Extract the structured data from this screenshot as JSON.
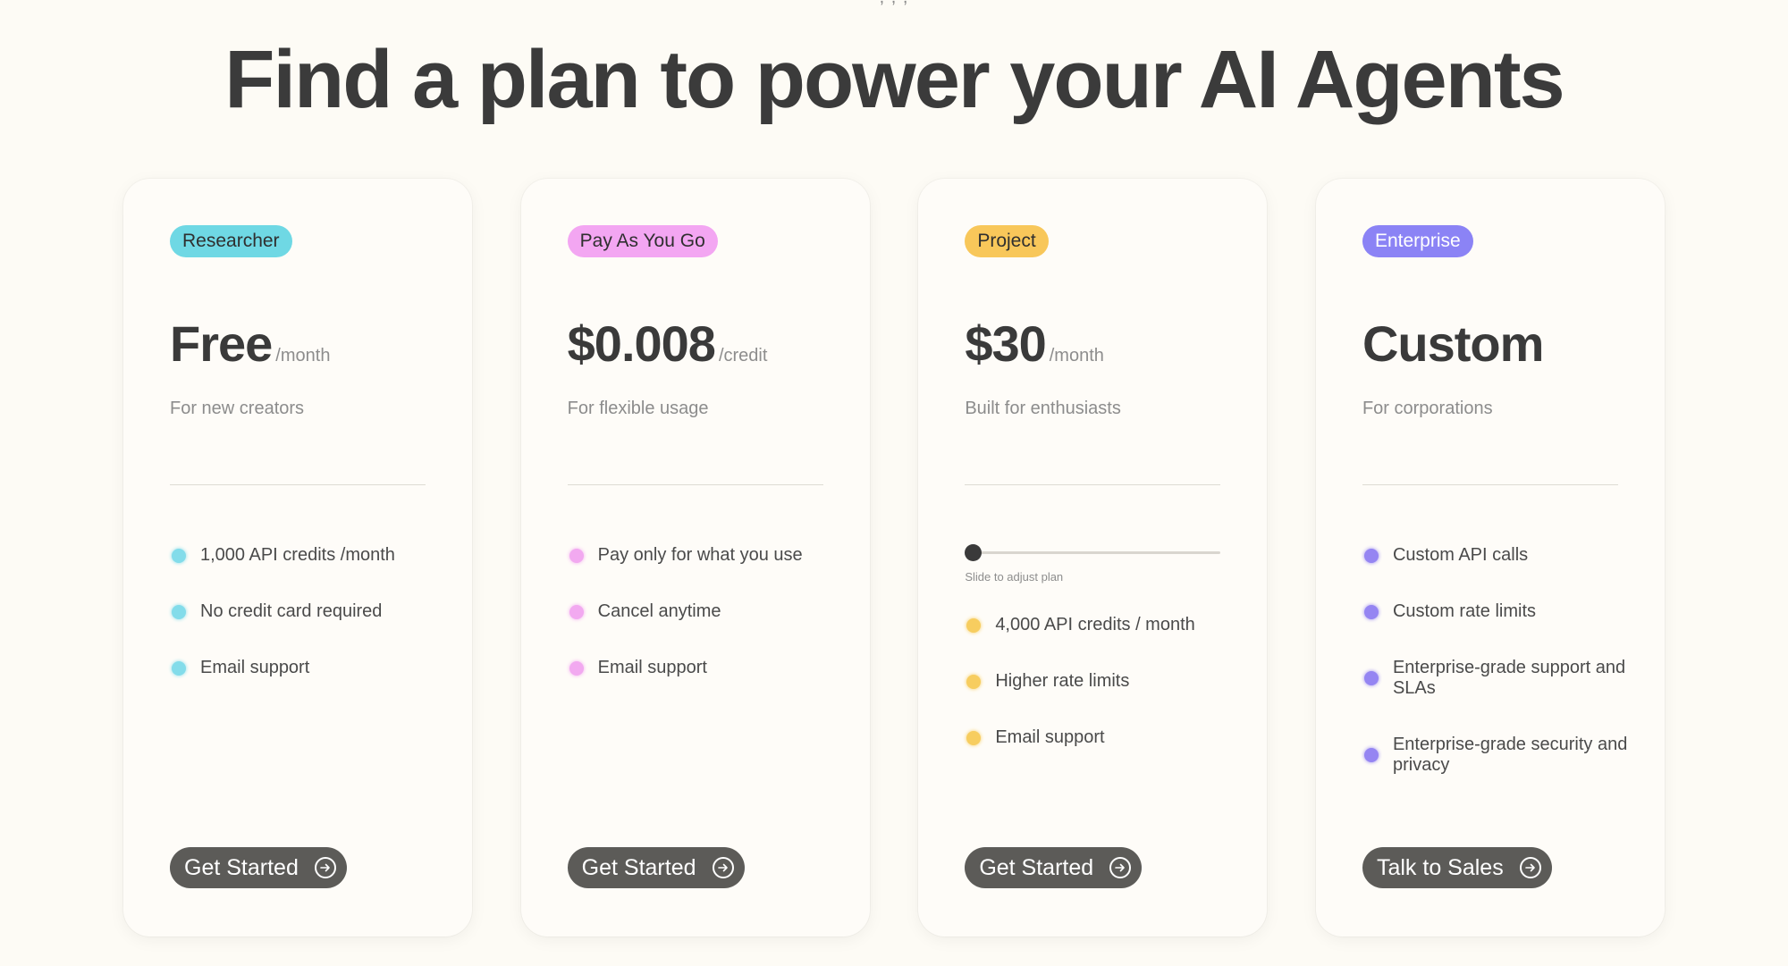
{
  "header": {
    "top_text": ", , ,",
    "title": "Find a plan to power your AI Agents"
  },
  "plans": [
    {
      "badge": "Researcher",
      "badge_color": "#6fd8e4",
      "price": "Free",
      "unit": "/month",
      "tagline": "For new creators",
      "dot_color": "#83dcea",
      "features": [
        "1,000 API credits /month",
        "No credit card required",
        "Email support"
      ],
      "cta": "Get Started",
      "cta_icon": "arrow-right-circle-icon"
    },
    {
      "badge": "Pay As You Go",
      "badge_color": "#f3a6f2",
      "price": "$0.008",
      "unit": "/credit",
      "tagline": "For flexible usage",
      "dot_color": "#f2a9f0",
      "features": [
        "Pay only for what you use",
        "Cancel anytime",
        "Email support"
      ],
      "cta": "Get Started",
      "cta_icon": "arrow-right-circle-icon"
    },
    {
      "badge": "Project",
      "badge_color": "#f8c75a",
      "price": "$30",
      "unit": "/month",
      "tagline": "Built for enthusiasts",
      "dot_color": "#f7cd5f",
      "slider": {
        "caption": "Slide to adjust plan",
        "value": 0
      },
      "features": [
        "4,000 API credits / month",
        "Higher rate limits",
        "Email support"
      ],
      "cta": "Get Started",
      "cta_icon": "arrow-right-circle-icon"
    },
    {
      "badge": "Enterprise",
      "badge_color": "#8b83f5",
      "price": "Custom",
      "unit": "",
      "tagline": "For corporations",
      "dot_color": "#9585f2",
      "features": [
        "Custom API calls",
        "Custom rate limits",
        "Enterprise-grade support and SLAs",
        "Enterprise-grade security and privacy"
      ],
      "cta": "Talk to Sales",
      "cta_icon": "arrow-right-circle-icon"
    }
  ]
}
